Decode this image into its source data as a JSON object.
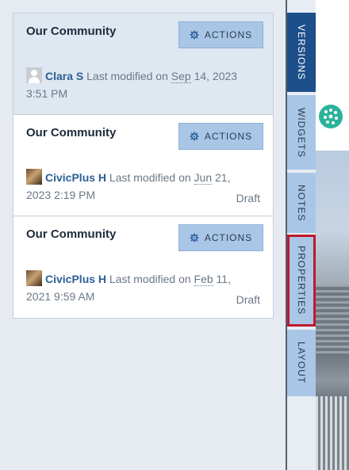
{
  "actions_label": "ACTIONS",
  "cards": [
    {
      "title": "Our Community",
      "author": "Clara S",
      "modified_prefix": "Last modified on",
      "date_part": "Sep",
      "date_rest": " 14, 2023 3:51 PM",
      "status": ""
    },
    {
      "title": "Our Community",
      "author": "CivicPlus H",
      "modified_prefix": "Last modified on",
      "date_part": "Jun",
      "date_rest": " 21, 2023 2:19 PM",
      "status": "Draft"
    },
    {
      "title": "Our Community",
      "author": "CivicPlus H",
      "modified_prefix": "Last modified on",
      "date_part": "Feb",
      "date_rest": " 11, 2021 9:59 AM",
      "status": "Draft"
    }
  ],
  "tabs": [
    {
      "label": "VERSIONS",
      "active": true
    },
    {
      "label": "WIDGETS"
    },
    {
      "label": "NOTES"
    },
    {
      "label": "PROPERTIES",
      "highlighted": true
    },
    {
      "label": "LAYOUT"
    }
  ],
  "colors": {
    "active_tab": "#1d4f8a",
    "tab": "#a9c6e6",
    "highlight": "#c0182c",
    "author_link": "#2c5f95"
  }
}
